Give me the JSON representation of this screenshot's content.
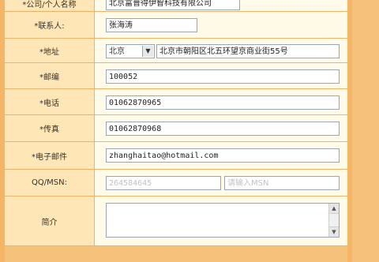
{
  "form": {
    "company": {
      "label": "*公司/个人名称",
      "value": "北京富普得伊智科技有限公司"
    },
    "contact": {
      "label": "*联系人:",
      "value": "张海涛"
    },
    "address": {
      "label": "*地址",
      "city": "北京",
      "value": "北京市朝阳区北五环望京商业街55号"
    },
    "postcode": {
      "label": "*邮编",
      "value": "100052"
    },
    "phone": {
      "label": "*电话",
      "value": "01062870965"
    },
    "fax": {
      "label": "*传真",
      "value": "01062870968"
    },
    "email": {
      "label": "*电子邮件",
      "value": "zhanghaitao@hotmail.com"
    },
    "qq": {
      "label": "QQ/MSN:",
      "qq_placeholder": "264584645",
      "msn_placeholder": "请输入MSN"
    },
    "intro": {
      "label": "简介",
      "value": ""
    }
  },
  "colors": {
    "frame": "#f5c27b",
    "label_bg": "#ffe6b6",
    "cell_bg": "#fffbe8",
    "input_border": "#9aa6b6"
  }
}
